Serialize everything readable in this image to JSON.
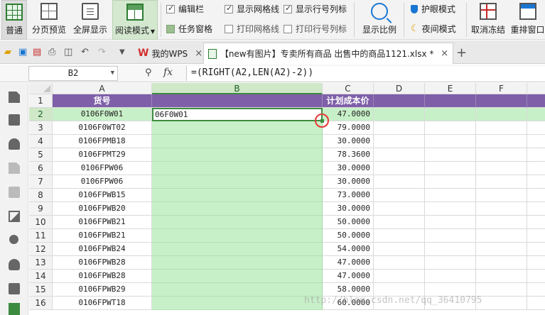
{
  "ribbon": {
    "buttons": [
      {
        "label": "普通",
        "icon": "normal-view-icon"
      },
      {
        "label": "分页预览",
        "icon": "page-break-icon"
      },
      {
        "label": "全屏显示",
        "icon": "fullscreen-icon"
      },
      {
        "label": "阅读模式",
        "icon": "reading-mode-icon"
      },
      {
        "label": "显示比例",
        "icon": "zoom-icon"
      },
      {
        "label": "取消冻结",
        "icon": "freeze-panes-icon"
      },
      {
        "label": "重排窗口",
        "icon": "arrange-window-icon"
      }
    ],
    "checkboxes": [
      {
        "label": "编辑栏",
        "checked": true
      },
      {
        "label": "任务窗格",
        "checked": true
      },
      {
        "label": "显示网格线",
        "checked": true
      },
      {
        "label": "打印网格线",
        "checked": false
      },
      {
        "label": "显示行号列标",
        "checked": true
      },
      {
        "label": "打印行号列标",
        "checked": false
      }
    ],
    "eye_mode": "护眼模式",
    "night_mode": "夜间模式"
  },
  "tabs": {
    "wps_tab": "我的WPS",
    "doc_tab": "【new有图片】专卖所有商品 出售中的商品1121.xlsx *",
    "close": "×",
    "add": "+"
  },
  "formula_bar": {
    "name_box": "B2",
    "fx": "fx",
    "formula": "=(RIGHT(A2,LEN(A2)-2))"
  },
  "sheet": {
    "columns": [
      "A",
      "B",
      "C",
      "D",
      "E",
      "F",
      "G"
    ],
    "row_numbers": [
      "1",
      "2",
      "3",
      "4",
      "5",
      "6",
      "7",
      "8",
      "9",
      "10",
      "11",
      "12",
      "13",
      "14",
      "15",
      "16"
    ],
    "header_row": {
      "A": "货号",
      "B": "",
      "C": "计划成本价"
    },
    "rows": [
      {
        "A": "0106F0W01",
        "B": "06F0W01",
        "C": "47.0000"
      },
      {
        "A": "0106F0WT02",
        "B": "",
        "C": "79.0000"
      },
      {
        "A": "0106FPMB18",
        "B": "",
        "C": "30.0000"
      },
      {
        "A": "0106FPMT29",
        "B": "",
        "C": "78.3600"
      },
      {
        "A": "0106FPW06",
        "B": "",
        "C": "30.0000"
      },
      {
        "A": "0106FPW06",
        "B": "",
        "C": "30.0000"
      },
      {
        "A": "0106FPWB15",
        "B": "",
        "C": "73.0000"
      },
      {
        "A": "0106FPWB20",
        "B": "",
        "C": "30.0000"
      },
      {
        "A": "0106FPWB21",
        "B": "",
        "C": "50.0000"
      },
      {
        "A": "0106FPWB21",
        "B": "",
        "C": "50.0000"
      },
      {
        "A": "0106FPWB24",
        "B": "",
        "C": "54.0000"
      },
      {
        "A": "0106FPWB28",
        "B": "",
        "C": "47.0000"
      },
      {
        "A": "0106FPWB28",
        "B": "",
        "C": "47.0000"
      },
      {
        "A": "0106FPWB29",
        "B": "",
        "C": "58.0000"
      },
      {
        "A": "0106FPWT18",
        "B": "",
        "C": "60.0000"
      }
    ],
    "selected_cell": "B2"
  },
  "watermark": "http://blog.csdn.net/qq_36410795"
}
